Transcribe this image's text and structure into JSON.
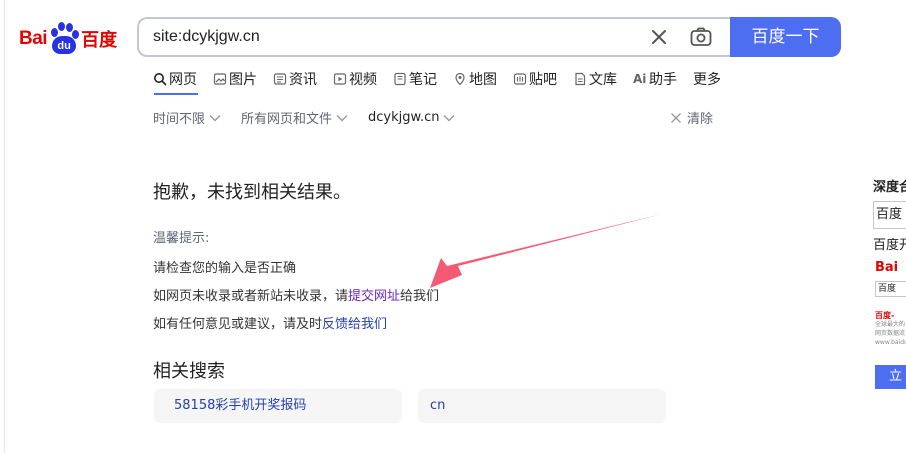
{
  "logo": {
    "bai": "Bai",
    "du": "du",
    "cn": "百度"
  },
  "search": {
    "value": "site:dcykjgw.cn",
    "button_label": "百度一下"
  },
  "tabs": [
    {
      "label": "网页",
      "icon": "search-icon"
    },
    {
      "label": "图片",
      "icon": "image-icon"
    },
    {
      "label": "资讯",
      "icon": "news-icon"
    },
    {
      "label": "视频",
      "icon": "video-icon"
    },
    {
      "label": "笔记",
      "icon": "note-icon"
    },
    {
      "label": "地图",
      "icon": "map-icon"
    },
    {
      "label": "贴吧",
      "icon": "tieba-icon"
    },
    {
      "label": "文库",
      "icon": "wenku-icon"
    },
    {
      "label": "助手",
      "icon": "ai-icon"
    },
    {
      "label": "更多",
      "icon": ""
    }
  ],
  "filters": {
    "time": "时间不限",
    "type": "所有网页和文件",
    "site": "dcykjgw.cn",
    "clear": "清除"
  },
  "main": {
    "no_result": "抱歉，未找到相关结果。",
    "tip_title": "温馨提示:",
    "tip1": "请检查您的输入是否正确",
    "tip2_before": "如网页未收录或者新站未收录，请",
    "tip2_link": "提交网址",
    "tip2_after": "给我们",
    "tip3_before": "如有任何意见或建议，请及时",
    "tip3_link": "反馈给我们"
  },
  "related": {
    "title": "相关搜索",
    "items": [
      "58158彩手机开奖报码",
      "cn"
    ]
  },
  "right_panel": {
    "title": "深度合",
    "box": "百度",
    "text": "百度开",
    "logo": "Bai",
    "mini": "百度",
    "small_line1": "百度-",
    "small_line2": "全球最大的",
    "small_line3": "网页数据流",
    "small_line4": "www.baidu",
    "button": "立"
  },
  "colors": {
    "brand_red": "#e10602",
    "brand_blue": "#2932e1",
    "accent": "#4e6ef2",
    "link_blue": "#2440b3",
    "link_visited": "#6c23bd",
    "arrow": "#f4516c"
  }
}
